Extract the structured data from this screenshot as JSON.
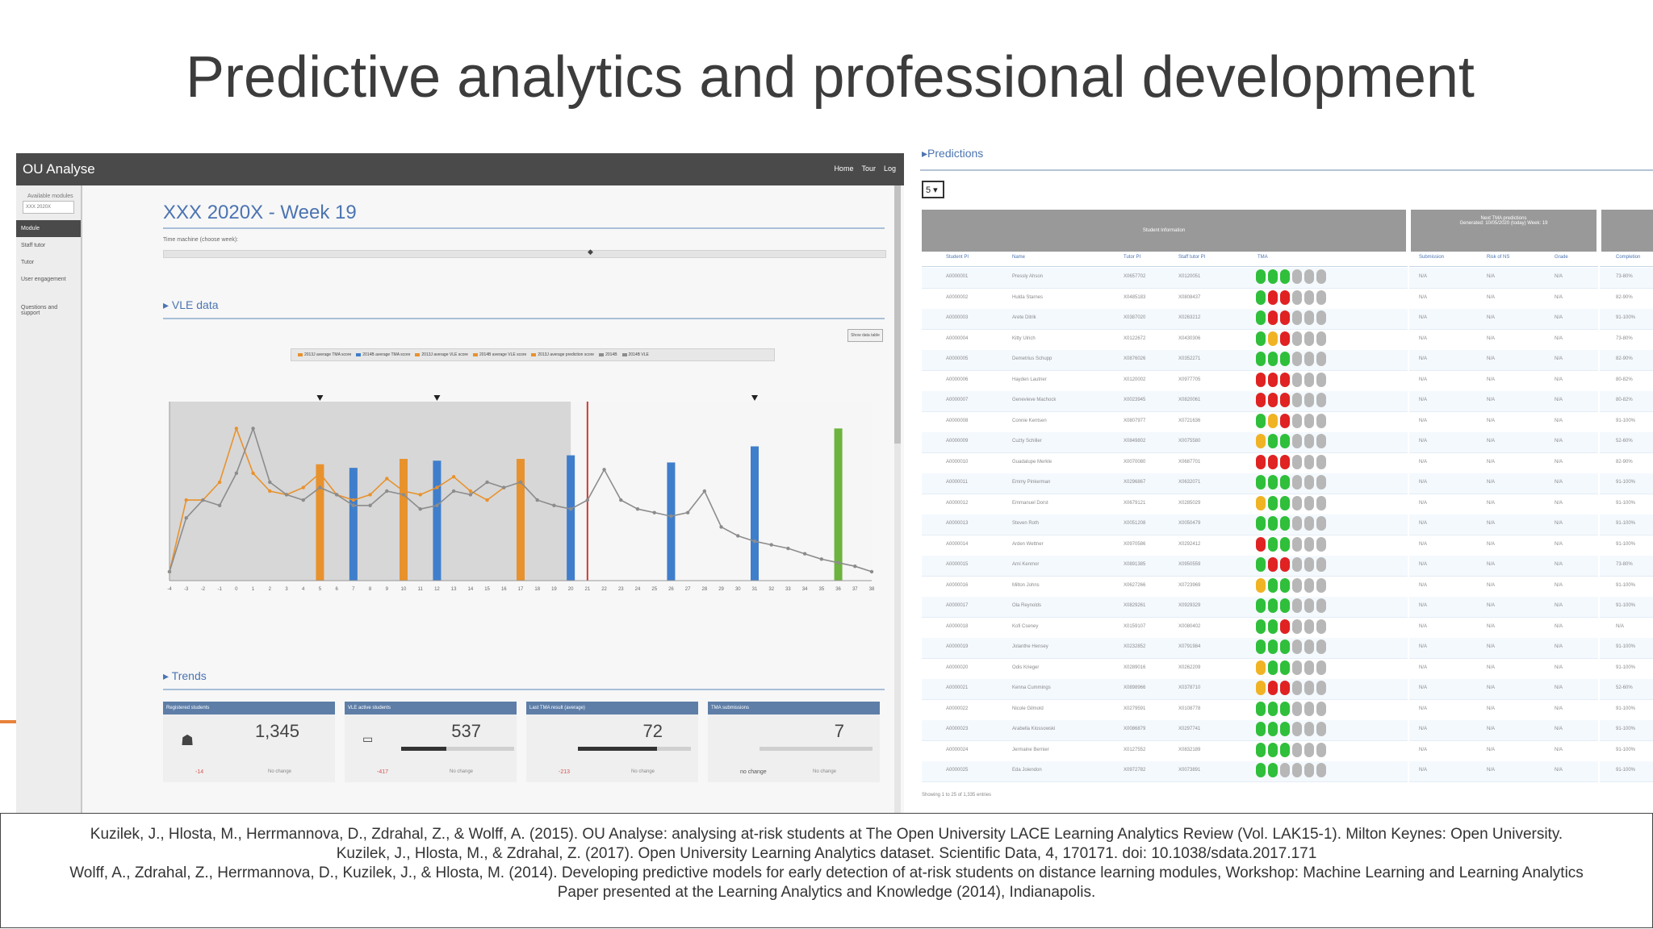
{
  "slide": {
    "title": "Predictive analytics and professional development",
    "references": [
      "Kuzilek, J., Hlosta, M., Herrmannova, D., Zdrahal, Z., & Wolff, A. (2015). OU Analyse: analysing at-risk students at The Open University LACE Learning Analytics Review (Vol. LAK15-1). Milton Keynes: Open University.",
      "Kuzilek, J., Hlosta, M., & Zdrahal, Z. (2017). Open University Learning Analytics dataset. Scientific Data, 4, 170171. doi: 10.1038/sdata.2017.171",
      "Wolff, A., Zdrahal, Z., Herrmannova, D., Kuzilek, J., & Hlosta, M. (2014). Developing predictive models for early detection of at-risk students on distance learning modules, Workshop: Machine Learning and Learning Analytics",
      "Paper presented at the Learning Analytics and Knowledge (2014), Indianapolis."
    ]
  },
  "dashboard": {
    "app_name": "OU Analyse",
    "top_links": [
      "Home",
      "Tour",
      "Log"
    ],
    "sidebar": {
      "module_label": "Available modules",
      "module_value": "XXX 2020X",
      "items": [
        "Module",
        "Staff tutor",
        "Tutor",
        "User engagement",
        "Questions and support"
      ]
    },
    "page_title": "XXX 2020X - Week 19",
    "timeline_label": "Time machine (choose week):",
    "vle_section": "VLE data",
    "trends_section": "Trends",
    "legend": [
      "2013J average TMA score",
      "2014B average TMA score",
      "2013J average VLE score",
      "2014B average VLE score",
      "2013J average prediction score",
      "2014B",
      "2014B VLE"
    ],
    "chart_button": "Show data table",
    "colors": {
      "orange": "#e8922d",
      "blue": "#3f7ecb",
      "green": "#6db33f",
      "red": "#d03a2f",
      "gray_line": "#8c8c8c"
    },
    "chart_data": {
      "type": "line",
      "x": [
        "-4",
        "-3",
        "-2",
        "-1",
        "0",
        "1",
        "2",
        "3",
        "4",
        "5",
        "6",
        "7",
        "8",
        "9",
        "10",
        "11",
        "12",
        "13",
        "14",
        "15",
        "16",
        "17",
        "18",
        "19",
        "20",
        "21",
        "22",
        "23",
        "24",
        "25",
        "26",
        "27",
        "28",
        "29",
        "30",
        "31",
        "32",
        "33",
        "34",
        "35",
        "36",
        "37",
        "38"
      ],
      "series": [
        {
          "values": [
            5,
            45,
            45,
            55,
            85,
            60,
            50,
            48,
            52,
            60,
            48,
            45,
            48,
            57,
            50,
            48,
            52,
            58,
            50,
            45,
            52,
            null,
            null,
            null,
            null,
            null,
            null,
            null,
            null,
            null,
            null,
            null,
            null,
            null,
            null,
            null,
            null,
            null,
            null,
            null,
            null,
            null,
            null
          ]
        },
        {
          "values": [
            5,
            35,
            45,
            42,
            60,
            85,
            55,
            48,
            45,
            52,
            48,
            42,
            42,
            50,
            48,
            40,
            42,
            50,
            48,
            55,
            52,
            55,
            45,
            42,
            40,
            45,
            62,
            45,
            40,
            38,
            36,
            38,
            50,
            30,
            25,
            22,
            20,
            18,
            15,
            12,
            10,
            8,
            5
          ]
        }
      ],
      "bars": [
        {
          "index": 9,
          "value": 65,
          "color": "orange"
        },
        {
          "index": 11,
          "value": 63,
          "color": "blue"
        },
        {
          "index": 14,
          "value": 68,
          "color": "orange"
        },
        {
          "index": 16,
          "value": 67,
          "color": "blue"
        },
        {
          "index": 21,
          "value": 68,
          "color": "orange"
        },
        {
          "index": 24,
          "value": 70,
          "color": "blue"
        },
        {
          "index": 30,
          "value": 66,
          "color": "blue"
        },
        {
          "index": 35,
          "value": 75,
          "color": "blue"
        },
        {
          "index": 40,
          "value": 85,
          "color": "green"
        }
      ],
      "current_week_index": 25,
      "ylim": [
        0,
        100
      ]
    },
    "cards": [
      {
        "title": "Registered students",
        "value": "1,345",
        "icon": "students-icon",
        "progress": 0,
        "foot_left": "-14",
        "foot_right": "No change"
      },
      {
        "title": "VLE active students",
        "value": "537",
        "icon": "monitor-icon",
        "progress": 0.4,
        "foot_left": "-417",
        "foot_right": "No change"
      },
      {
        "title": "Last TMA result (average)",
        "value": "72",
        "icon": "",
        "progress": 0.7,
        "foot_left": "-213",
        "foot_right": "No change"
      },
      {
        "title": "TMA submissions",
        "value": "7",
        "icon": "",
        "progress": 0,
        "foot_left": "no change",
        "foot_right": "No change"
      }
    ]
  },
  "predictions": {
    "title": "Predictions",
    "select_value": "5",
    "group_headers": [
      "Student Information",
      "Next TMA predictions",
      ""
    ],
    "group_sub": "Generated: 10/05/2020 (today) Week: 19",
    "columns": [
      "Student PI",
      "Name",
      "Tutor PI",
      "Staff tutor PI",
      "TMA",
      "Submission",
      "Risk of NS",
      "Grade",
      "Completion"
    ],
    "rows": [
      {
        "pi": "A0000001",
        "name": "Pressly Ahson",
        "tutor": "X0657702",
        "staff": "X0120051",
        "tma": "gggxxx",
        "sub": "N/A",
        "risk": "N/A",
        "grade": "N/A",
        "comp": "73-80%"
      },
      {
        "pi": "A0000002",
        "name": "Hulda Starnes",
        "tutor": "X0485183",
        "staff": "X0808437",
        "tma": "grrxxx",
        "sub": "N/A",
        "risk": "N/A",
        "grade": "N/A",
        "comp": "82-90%"
      },
      {
        "pi": "A0000003",
        "name": "Arete Ditrik",
        "tutor": "X0387020",
        "staff": "X0263212",
        "tma": "grrxxx",
        "sub": "N/A",
        "risk": "N/A",
        "grade": "N/A",
        "comp": "91-100%"
      },
      {
        "pi": "A0000004",
        "name": "Kitty Ulrich",
        "tutor": "X0122672",
        "staff": "X0430306",
        "tma": "gyrxxx",
        "sub": "N/A",
        "risk": "N/A",
        "grade": "N/A",
        "comp": "73-80%"
      },
      {
        "pi": "A0000005",
        "name": "Demetrius Schupp",
        "tutor": "X0876026",
        "staff": "X0352271",
        "tma": "gggxxx",
        "sub": "N/A",
        "risk": "N/A",
        "grade": "N/A",
        "comp": "82-90%"
      },
      {
        "pi": "A0000006",
        "name": "Hayden Lautner",
        "tutor": "X0120002",
        "staff": "X0977705",
        "tma": "rrrxxx",
        "sub": "N/A",
        "risk": "N/A",
        "grade": "N/A",
        "comp": "80-82%"
      },
      {
        "pi": "A0000007",
        "name": "Genevieve Machock",
        "tutor": "X0023945",
        "staff": "X0820061",
        "tma": "rrrxxx",
        "sub": "N/A",
        "risk": "N/A",
        "grade": "N/A",
        "comp": "80-82%"
      },
      {
        "pi": "A0000008",
        "name": "Connie Kentsen",
        "tutor": "X0807977",
        "staff": "X0721636",
        "tma": "gyrxxx",
        "sub": "N/A",
        "risk": "N/A",
        "grade": "N/A",
        "comp": "91-100%"
      },
      {
        "pi": "A0000009",
        "name": "Cuzty Schiller",
        "tutor": "X0849802",
        "staff": "X0075580",
        "tma": "yggxxx",
        "sub": "N/A",
        "risk": "N/A",
        "grade": "N/A",
        "comp": "52-60%"
      },
      {
        "pi": "A0000010",
        "name": "Guadalupe Merkle",
        "tutor": "X0070080",
        "staff": "X0687701",
        "tma": "rrrxxx",
        "sub": "N/A",
        "risk": "N/A",
        "grade": "N/A",
        "comp": "82-90%"
      },
      {
        "pi": "A0000011",
        "name": "Emmy Pinkerman",
        "tutor": "X0296867",
        "staff": "X0632071",
        "tma": "gggxxx",
        "sub": "N/A",
        "risk": "N/A",
        "grade": "N/A",
        "comp": "91-100%"
      },
      {
        "pi": "A0000012",
        "name": "Emmanuel Dorst",
        "tutor": "X0679121",
        "staff": "X0285029",
        "tma": "yggxxx",
        "sub": "N/A",
        "risk": "N/A",
        "grade": "N/A",
        "comp": "91-100%"
      },
      {
        "pi": "A0000013",
        "name": "Steven Roth",
        "tutor": "X0051208",
        "staff": "X0050479",
        "tma": "gggxxx",
        "sub": "N/A",
        "risk": "N/A",
        "grade": "N/A",
        "comp": "91-100%"
      },
      {
        "pi": "A0000014",
        "name": "Arden Wettner",
        "tutor": "X0970586",
        "staff": "X0292412",
        "tma": "rggxxx",
        "sub": "N/A",
        "risk": "N/A",
        "grade": "N/A",
        "comp": "91-100%"
      },
      {
        "pi": "A0000015",
        "name": "Arni Kenmor",
        "tutor": "X0891385",
        "staff": "X0950559",
        "tma": "grrxxx",
        "sub": "N/A",
        "risk": "N/A",
        "grade": "N/A",
        "comp": "73-80%"
      },
      {
        "pi": "A0000016",
        "name": "Milton Johns",
        "tutor": "X0627266",
        "staff": "X0723969",
        "tma": "yggxxx",
        "sub": "N/A",
        "risk": "N/A",
        "grade": "N/A",
        "comp": "91-100%"
      },
      {
        "pi": "A0000017",
        "name": "Ola Reynolds",
        "tutor": "X0829261",
        "staff": "X0929329",
        "tma": "gggxxx",
        "sub": "N/A",
        "risk": "N/A",
        "grade": "N/A",
        "comp": "91-100%"
      },
      {
        "pi": "A0000018",
        "name": "Kofi Cseney",
        "tutor": "X0159107",
        "staff": "X0080402",
        "tma": "ggrxxx",
        "sub": "N/A",
        "risk": "N/A",
        "grade": "N/A",
        "comp": "N/A"
      },
      {
        "pi": "A0000019",
        "name": "Jolanthe Hensey",
        "tutor": "X0232852",
        "staff": "X0791984",
        "tma": "gggxxx",
        "sub": "N/A",
        "risk": "N/A",
        "grade": "N/A",
        "comp": "91-100%"
      },
      {
        "pi": "A0000020",
        "name": "Odis Krieger",
        "tutor": "X0289016",
        "staff": "X0262209",
        "tma": "yggxxx",
        "sub": "N/A",
        "risk": "N/A",
        "grade": "N/A",
        "comp": "91-100%"
      },
      {
        "pi": "A0000021",
        "name": "Kenna Cummings",
        "tutor": "X0898966",
        "staff": "X0378710",
        "tma": "yrrxxx",
        "sub": "N/A",
        "risk": "N/A",
        "grade": "N/A",
        "comp": "52-60%"
      },
      {
        "pi": "A0000022",
        "name": "Nicole Gilmold",
        "tutor": "X0279591",
        "staff": "X0108778",
        "tma": "gggxxx",
        "sub": "N/A",
        "risk": "N/A",
        "grade": "N/A",
        "comp": "91-100%"
      },
      {
        "pi": "A0000023",
        "name": "Arabella Klossowski",
        "tutor": "X0086879",
        "staff": "X0297741",
        "tma": "gggxxx",
        "sub": "N/A",
        "risk": "N/A",
        "grade": "N/A",
        "comp": "91-100%"
      },
      {
        "pi": "A0000024",
        "name": "Jermaine Bernier",
        "tutor": "X0127552",
        "staff": "X0832189",
        "tma": "gggxxx",
        "sub": "N/A",
        "risk": "N/A",
        "grade": "N/A",
        "comp": "91-100%"
      },
      {
        "pi": "A0000025",
        "name": "Eda Joiendon",
        "tutor": "X0972782",
        "staff": "X0073891",
        "tma": "ggxxxx",
        "sub": "N/A",
        "risk": "N/A",
        "grade": "N/A",
        "comp": "91-100%"
      }
    ],
    "footer": "Showing 1 to 25 of 1,335 entries"
  }
}
